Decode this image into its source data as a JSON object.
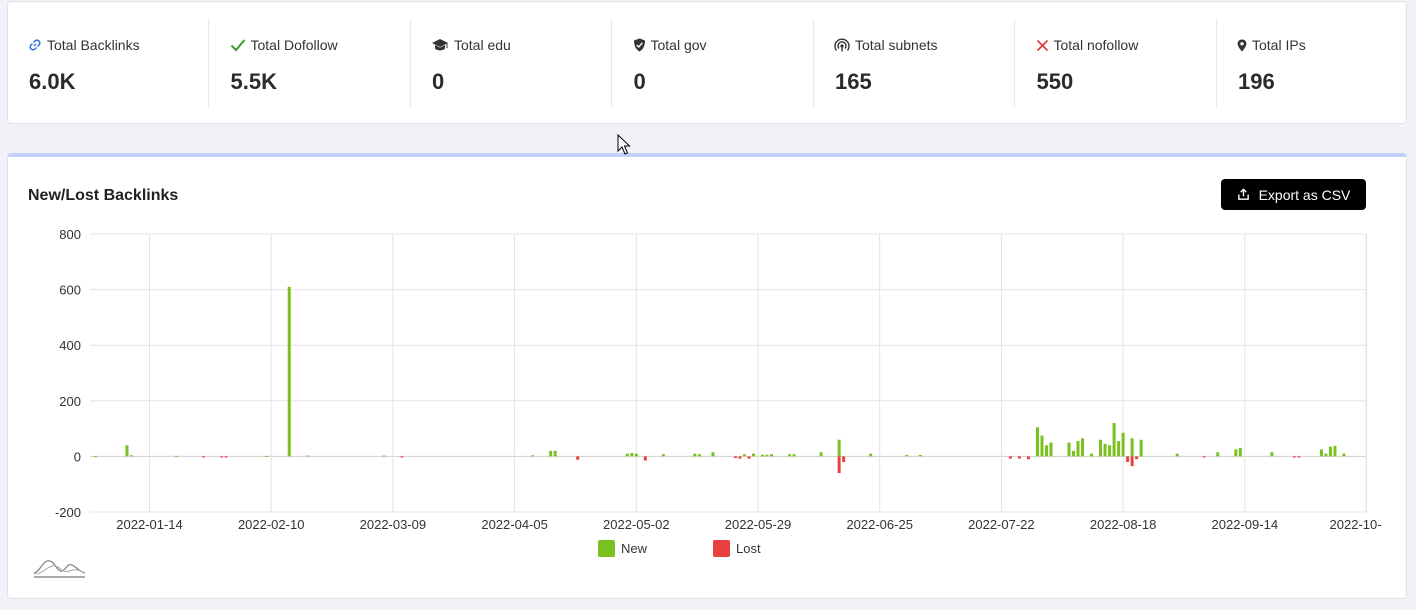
{
  "stats": [
    {
      "label": "Total Backlinks",
      "value": "6.0K",
      "icon": "link-icon",
      "color": "#2f6fd9"
    },
    {
      "label": "Total Dofollow",
      "value": "5.5K",
      "icon": "check-icon",
      "color": "#3c9a2f"
    },
    {
      "label": "Total edu",
      "value": "0",
      "icon": "graduation-cap-icon",
      "color": "#333333"
    },
    {
      "label": "Total gov",
      "value": "0",
      "icon": "shield-icon",
      "color": "#333333"
    },
    {
      "label": "Total subnets",
      "value": "165",
      "icon": "signal-icon",
      "color": "#333333"
    },
    {
      "label": "Total nofollow",
      "value": "550",
      "icon": "x-mark-icon",
      "color": "#e03b3b"
    },
    {
      "label": "Total IPs",
      "value": "196",
      "icon": "map-pin-icon",
      "color": "#333333"
    }
  ],
  "panel": {
    "title": "New/Lost Backlinks",
    "export_label": "Export as CSV"
  },
  "chart_data": {
    "type": "bar",
    "title": "New/Lost Backlinks",
    "x_labels": [
      "2022-01-14",
      "2022-02-10",
      "2022-03-09",
      "2022-04-05",
      "2022-05-02",
      "2022-05-29",
      "2022-06-25",
      "2022-07-22",
      "2022-08-18",
      "2022-09-14",
      "2022-10-"
    ],
    "y_ticks": [
      800,
      600,
      400,
      200,
      0,
      -200
    ],
    "ylim": [
      -200,
      800
    ],
    "grid": true,
    "legend_position": "bottom-center",
    "series": [
      {
        "name": "New",
        "color": "#79c11f",
        "points": [
          [
            "2022-01-02",
            1
          ],
          [
            "2022-01-09",
            40
          ],
          [
            "2022-01-10",
            4
          ],
          [
            "2022-01-20",
            2
          ],
          [
            "2022-02-09",
            2
          ],
          [
            "2022-02-14",
            610
          ],
          [
            "2022-02-18",
            3
          ],
          [
            "2022-03-07",
            3
          ],
          [
            "2022-04-09",
            4
          ],
          [
            "2022-04-13",
            20
          ],
          [
            "2022-04-14",
            20
          ],
          [
            "2022-04-30",
            10
          ],
          [
            "2022-05-01",
            12
          ],
          [
            "2022-05-02",
            10
          ],
          [
            "2022-05-08",
            8
          ],
          [
            "2022-05-15",
            10
          ],
          [
            "2022-05-16",
            8
          ],
          [
            "2022-05-19",
            15
          ],
          [
            "2022-05-26",
            8
          ],
          [
            "2022-05-28",
            10
          ],
          [
            "2022-05-30",
            6
          ],
          [
            "2022-05-31",
            6
          ],
          [
            "2022-06-01",
            8
          ],
          [
            "2022-06-05",
            8
          ],
          [
            "2022-06-06",
            8
          ],
          [
            "2022-06-12",
            15
          ],
          [
            "2022-06-16",
            60
          ],
          [
            "2022-06-23",
            10
          ],
          [
            "2022-07-01",
            5
          ],
          [
            "2022-07-04",
            5
          ],
          [
            "2022-07-30",
            105
          ],
          [
            "2022-07-31",
            75
          ],
          [
            "2022-08-01",
            40
          ],
          [
            "2022-08-02",
            50
          ],
          [
            "2022-08-06",
            50
          ],
          [
            "2022-08-07",
            20
          ],
          [
            "2022-08-08",
            55
          ],
          [
            "2022-08-09",
            65
          ],
          [
            "2022-08-11",
            10
          ],
          [
            "2022-08-13",
            60
          ],
          [
            "2022-08-14",
            45
          ],
          [
            "2022-08-15",
            40
          ],
          [
            "2022-08-16",
            120
          ],
          [
            "2022-08-17",
            55
          ],
          [
            "2022-08-18",
            85
          ],
          [
            "2022-08-20",
            65
          ],
          [
            "2022-08-22",
            60
          ],
          [
            "2022-08-30",
            10
          ],
          [
            "2022-09-08",
            15
          ],
          [
            "2022-09-12",
            25
          ],
          [
            "2022-09-13",
            30
          ],
          [
            "2022-09-20",
            15
          ],
          [
            "2022-10-01",
            25
          ],
          [
            "2022-10-02",
            10
          ],
          [
            "2022-10-03",
            35
          ],
          [
            "2022-10-04",
            38
          ],
          [
            "2022-10-06",
            10
          ]
        ]
      },
      {
        "name": "Lost",
        "color": "#e8403f",
        "points": [
          [
            "2022-01-26",
            -3
          ],
          [
            "2022-01-30",
            -4
          ],
          [
            "2022-01-31",
            -4
          ],
          [
            "2022-03-11",
            -4
          ],
          [
            "2022-04-19",
            -12
          ],
          [
            "2022-05-04",
            -15
          ],
          [
            "2022-05-24",
            -6
          ],
          [
            "2022-05-25",
            -8
          ],
          [
            "2022-05-27",
            -8
          ],
          [
            "2022-06-16",
            -60
          ],
          [
            "2022-06-17",
            -20
          ],
          [
            "2022-07-24",
            -8
          ],
          [
            "2022-07-26",
            -8
          ],
          [
            "2022-07-28",
            -10
          ],
          [
            "2022-08-19",
            -20
          ],
          [
            "2022-08-20",
            -35
          ],
          [
            "2022-08-21",
            -10
          ],
          [
            "2022-09-05",
            -3
          ],
          [
            "2022-09-25",
            -4
          ],
          [
            "2022-09-26",
            -4
          ]
        ]
      }
    ]
  }
}
